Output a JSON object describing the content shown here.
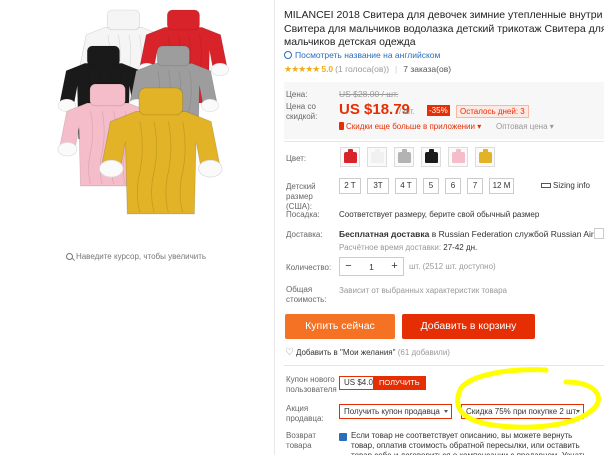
{
  "product": {
    "title": "MILANCEI 2018 Свитера для девочек зимние утепленные внутри Свитера для мальчиков водолазка детский трикотаж Свитера для мальчиков детская одежда",
    "translate_link": "Посмотреть название на английском",
    "rating": {
      "stars": "★★★★★",
      "value": "5.0",
      "votes": "(1 голоса(ов))",
      "orders": "7 заказа(ов)"
    },
    "zoom_hint": "Наведите курсор, чтобы увеличить",
    "sweater_colors": [
      "#f5f5f5",
      "#d8232a",
      "#1a1a1a",
      "#9d9d9d",
      "#f4bdc9",
      "#e2b326"
    ]
  },
  "price": {
    "old_label": "Цена:",
    "old_value": "US $28.00 / шт.",
    "sale_label": "Цена со скидкой:",
    "sale_value": "US $18.79",
    "sale_unit": "/ шт.",
    "discount": "-35%",
    "days_left": "Осталось дней: 3",
    "app_discount": "Скидки еще больше в приложении",
    "wholesale": "Оптовая цена"
  },
  "options": {
    "color_label": "Цвет:",
    "color_swatches": [
      "#d8232a",
      "#f0f0f0",
      "#b3b3b3",
      "#1a1a1a",
      "#f4bdc9",
      "#e2b326"
    ],
    "size_label": "Детский размер (США):",
    "sizes": [
      "2 T",
      "3T",
      "4 T",
      "5",
      "6",
      "7",
      "12 M"
    ],
    "size_info": "Sizing info",
    "fit_label": "Посадка:",
    "fit_text": "Соответствует размеру, берите свой обычный размер"
  },
  "shipping": {
    "label": "Доставка:",
    "free": "Бесплатная доставка",
    "to": "в Russian Federation службой Russian Air",
    "time_label": "Расчётное время доставки:",
    "time_value": "27-42 дн."
  },
  "quantity": {
    "label": "Количество:",
    "value": "1",
    "minus": "−",
    "plus": "+",
    "unit": "шт. (2512 шт. доступно)"
  },
  "total": {
    "label": "Общая стоимость:",
    "text": "Зависит от выбранных характеристик товара"
  },
  "actions": {
    "buy_now": "Купить сейчас",
    "add_to_cart": "Добавить в корзину",
    "wishlist": "Добавить в \"Мои желания\"",
    "wishlist_count": "(61 добавили)"
  },
  "coupons": {
    "new_user_label": "Купон нового пользователя",
    "new_user_value": "US $4.00",
    "new_user_button": "ПОЛУЧИТЬ",
    "promo_label": "Акция продавца:",
    "promo_coupon": "Получить купон продавца",
    "promo_deal": "Скидка 75% при покупке 2 шт.",
    "return_label": "Возврат товара",
    "return_text": "Если товар не соответствует описанию, вы можете вернуть товар, оплатив стоимость обратной пересылки, или оставить товар себе и договориться о компенсации с продавцом. Узнать подробнее"
  },
  "annotation": {
    "highlight_color": "#ffff00"
  }
}
